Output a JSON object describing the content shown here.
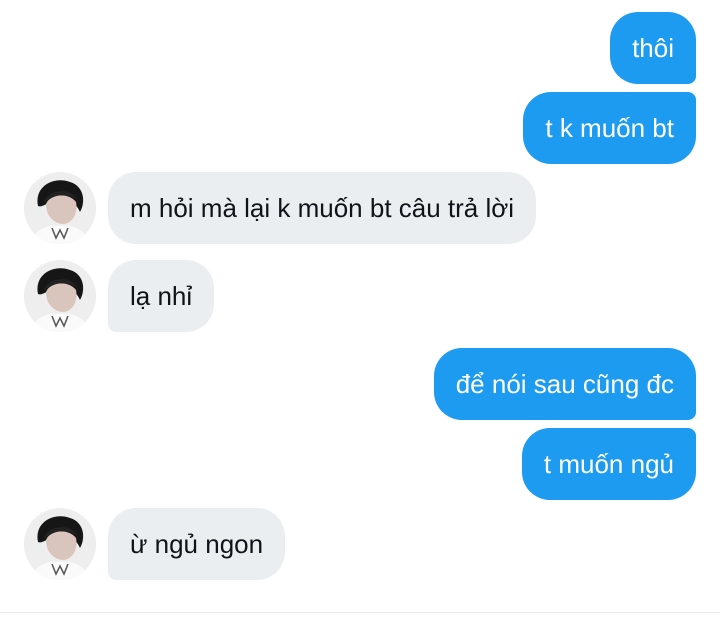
{
  "messages": [
    {
      "sender": "me",
      "text": "thôi"
    },
    {
      "sender": "me",
      "text": "t k muốn bt"
    },
    {
      "sender": "them",
      "text": "m hỏi mà lại k muốn bt câu trả lời"
    },
    {
      "sender": "them",
      "text": "lạ nhỉ"
    },
    {
      "sender": "me",
      "text": "để nói sau cũng đc"
    },
    {
      "sender": "me",
      "text": "t muốn ngủ"
    },
    {
      "sender": "them",
      "text": "ừ ngủ ngon"
    }
  ],
  "colors": {
    "outgoing_bubble": "#1d9bf0",
    "incoming_bubble": "#ebeef1",
    "outgoing_text": "#ffffff",
    "incoming_text": "#0f1419"
  },
  "icons": {
    "avatar": "contact-photo-dark-haired-person"
  }
}
